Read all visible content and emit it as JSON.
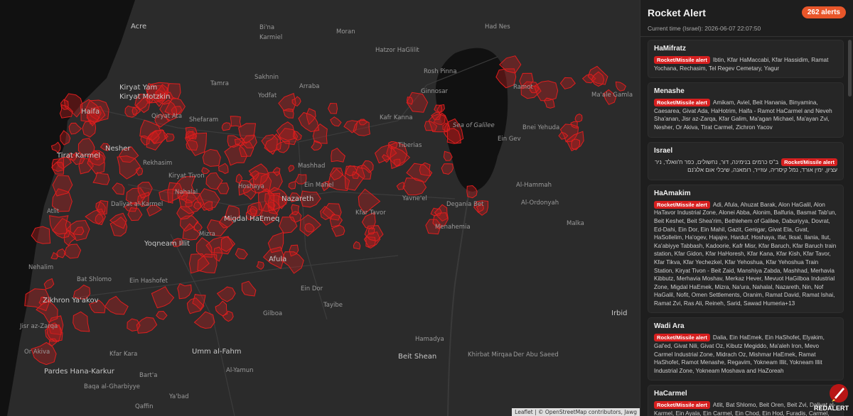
{
  "map": {
    "places": [
      {
        "name": "Acre",
        "big": true
      },
      {
        "name": "Kiryat Yam",
        "big": true
      },
      {
        "name": "Kiryat Motzkin",
        "big": true
      },
      {
        "name": "Haifa",
        "big": true
      },
      {
        "name": "Tirat Karmel",
        "big": true
      },
      {
        "name": "Atlit",
        "big": false
      },
      {
        "name": "Nesher",
        "big": true
      },
      {
        "name": "Rekhasim",
        "big": false
      },
      {
        "name": "Qiryat Ata",
        "big": false
      },
      {
        "name": "Shefaram",
        "big": false
      },
      {
        "name": "Tamra",
        "big": false
      },
      {
        "name": "Sakhnin",
        "big": false
      },
      {
        "name": "Arraba",
        "big": false
      },
      {
        "name": "Karmiel",
        "big": false
      },
      {
        "name": "Bi'na",
        "big": false
      },
      {
        "name": "Kiryat Tivon",
        "big": false
      },
      {
        "name": "Nazareth",
        "big": true
      },
      {
        "name": "Ein Mahel",
        "big": false
      },
      {
        "name": "Mashhad",
        "big": false
      },
      {
        "name": "Migdal HaEmeq",
        "big": true
      },
      {
        "name": "Dalīyat al-Karmel",
        "big": false
      },
      {
        "name": "Yoqneam Illit",
        "big": true
      },
      {
        "name": "Afula",
        "big": true
      },
      {
        "name": "Zikhron Ya'akov",
        "big": true
      },
      {
        "name": "Jisr az-Zarqa",
        "big": false
      },
      {
        "name": "Or Akiva",
        "big": false
      },
      {
        "name": "Kfar Kara",
        "big": false
      },
      {
        "name": "Pardes Hana-Karkur",
        "big": true
      },
      {
        "name": "Umm al-Fahm",
        "big": true
      },
      {
        "name": "Bart'a",
        "big": false
      },
      {
        "name": "Baqa al-Gharbiyye",
        "big": false
      },
      {
        "name": "Ya'bad",
        "big": false
      },
      {
        "name": "Qaffin",
        "big": false
      },
      {
        "name": "Al-Yamun",
        "big": false
      },
      {
        "name": "Beit Shean",
        "big": true
      },
      {
        "name": "Der Abu Saeed",
        "big": false
      },
      {
        "name": "Khirbat Mirqaa",
        "big": false
      },
      {
        "name": "Hamadya",
        "big": false
      },
      {
        "name": "Gilboa",
        "big": false
      },
      {
        "name": "Kafr Kanna",
        "big": false
      },
      {
        "name": "Tiberias",
        "big": false
      },
      {
        "name": "Yavne'el",
        "big": false
      },
      {
        "name": "Kfar Tavor",
        "big": false
      },
      {
        "name": "Degania Bet",
        "big": false
      },
      {
        "name": "Menahemia",
        "big": false
      },
      {
        "name": "Ginnosar",
        "big": false
      },
      {
        "name": "Ein Gev",
        "big": false
      },
      {
        "name": "Ramot",
        "big": false
      },
      {
        "name": "Bnei Yehuda",
        "big": false
      },
      {
        "name": "Ma'ale Gamla",
        "big": false
      },
      {
        "name": "Al-Hammah",
        "big": false
      },
      {
        "name": "Al-Ordonyah",
        "big": false
      },
      {
        "name": "Malka",
        "big": false
      },
      {
        "name": "Irbid",
        "big": true
      },
      {
        "name": "Hatzor HaGlilit",
        "big": false
      },
      {
        "name": "Rosh Pinna",
        "big": false
      },
      {
        "name": "Had Nes",
        "big": false
      },
      {
        "name": "Moran",
        "big": false
      },
      {
        "name": "Yodfat",
        "big": false
      },
      {
        "name": "Hoshaya",
        "big": false
      },
      {
        "name": "Nahalal",
        "big": false
      },
      {
        "name": "Mizra",
        "big": false
      },
      {
        "name": "Ein Dor",
        "big": false
      },
      {
        "name": "Bat Shlomo",
        "big": false
      },
      {
        "name": "Ein Hashofet",
        "big": false
      },
      {
        "name": "Nehalim",
        "big": false
      },
      {
        "name": "Tayibe",
        "big": false
      },
      {
        "name": "Sea of Galilee",
        "big": false,
        "sea": true
      }
    ],
    "attribution": "Leaflet | © OpenStreetMap contributors, Jawg",
    "water_color": "#111111",
    "land_color": "#2b2b2b",
    "alert_color": "#e01e1e"
  },
  "panel": {
    "title": "Rocket Alert",
    "alert_count": "262 alerts",
    "current_time": "Current time (Israel): 2026-06-07 22:07:50",
    "logo_text": "REDALERT"
  },
  "regions": [
    {
      "name": "HaMifratz",
      "badge": "Rocket/Missile alert",
      "places": "Ibtin, Kfar HaMaccabi, Kfar Hassidim, Ramat Yochana, Rechasim, Tel Regev Cemetary, Yagur",
      "rtl": false
    },
    {
      "name": "Menashe",
      "badge": "Rocket/Missile alert",
      "places": "Amikam, Aviel, Beit Hanania, Binyamina, Caesarea, Givat Ada, HaHotrim, Haifa - Ramot HaCarmel and Neveh Sha'anan, Jisr az-Zarqa, Kfar Galim, Ma'agan Michael, Ma'ayan Zvi, Nesher, Or Akiva, Tirat Carmel, Zichron Yacov",
      "rtl": false
    },
    {
      "name": "Israel",
      "badge": "Rocket/Missile alert",
      "places": "ב\"ס כרמים בנימינה, דור, נחשולים, כפר ח'וואלד, ניר עציון, ימין אורד, נמל קיסריה, עוזייר, רומאנה, שיבלי אום אלג'נם",
      "rtl": true
    },
    {
      "name": "HaAmakim",
      "badge": "Rocket/Missile alert",
      "places": "Adi, Afula, Ahuzat Barak, Alon HaGalil, Alon HaTavor Industrial Zone, Alonei Abba, Alonim, Balfuria, Basmat Tab'un, Beit Keshet, Beit Shea'rim, Bethlehem of Galilee, Daburiyya, Dovrat, Ed-Dahi, Ein Dor, Ein Mahil, Gazit, Genigar, Givat Ela, Gvat, HaSollelim, Ha'ogev, Hajajre, Harduf, Hoshaya, Ifat, Iksal, Ilania, Ilut, Ka'abiyye Tabbash, Kadoorie, Kafr Misr, Kfar Baruch, Kfar Baruch train station, Kfar Gidon, Kfar HaHoresh, Kfar Kana, Kfar Kish, Kfar Tavor, Kfar Tikva, Kfar Yechezkel, Kfar Yehoshua, Kfar Yehoshua Train Station, Kiryat Tivon - Beit Zaid, Manshiya Zabda, Mashhad, Merhavia Kibbutz, Merhavia Moshav, Merkaz Hever, Mevuot HaGilboa Industrial Zone, Migdal HaEmek, Mizra, Na'ura, Nahalal, Nazareth, Nin, Nof HaGalil, Nofit, Omen Settlements, Oranim, Ramat David, Ramat Ishai, Ramat Zvi, Ras Ali, Reineh, Sarid, Sawad Humeria+13",
      "rtl": false
    },
    {
      "name": "Wadi Ara",
      "badge": "Rocket/Missile alert",
      "places": "Dalia, Ein HaEmek, Ein HaShofet, Elyakim, Gal'ed, Givat Nili, Givat Oz, Kibutz Megiddo, Ma'aleh Iron, Mevo Carmel Industrial Zone, Midrach Oz, Mishmar HaEmek, Ramat HaShofet, Ramot Menashe, Regavim, Yokneam Illit, Yokneam Illit Industrial Zone, Yokneam Moshava and HaZoreah",
      "rtl": false
    },
    {
      "name": "HaCarmel",
      "badge": "Rocket/Missile alert",
      "places": "Atlit, Bat Shlomo, Beit Oren, Beit Zvi, Daliyat al-Karmel, Ein Ayala, Ein Carmel, Ein Chod, Ein Hod, Furadis, Carmel, Givat Wolfson, HaBonim, Isfiya, Kerem Maharal, Kishon",
      "rtl": false
    }
  ]
}
